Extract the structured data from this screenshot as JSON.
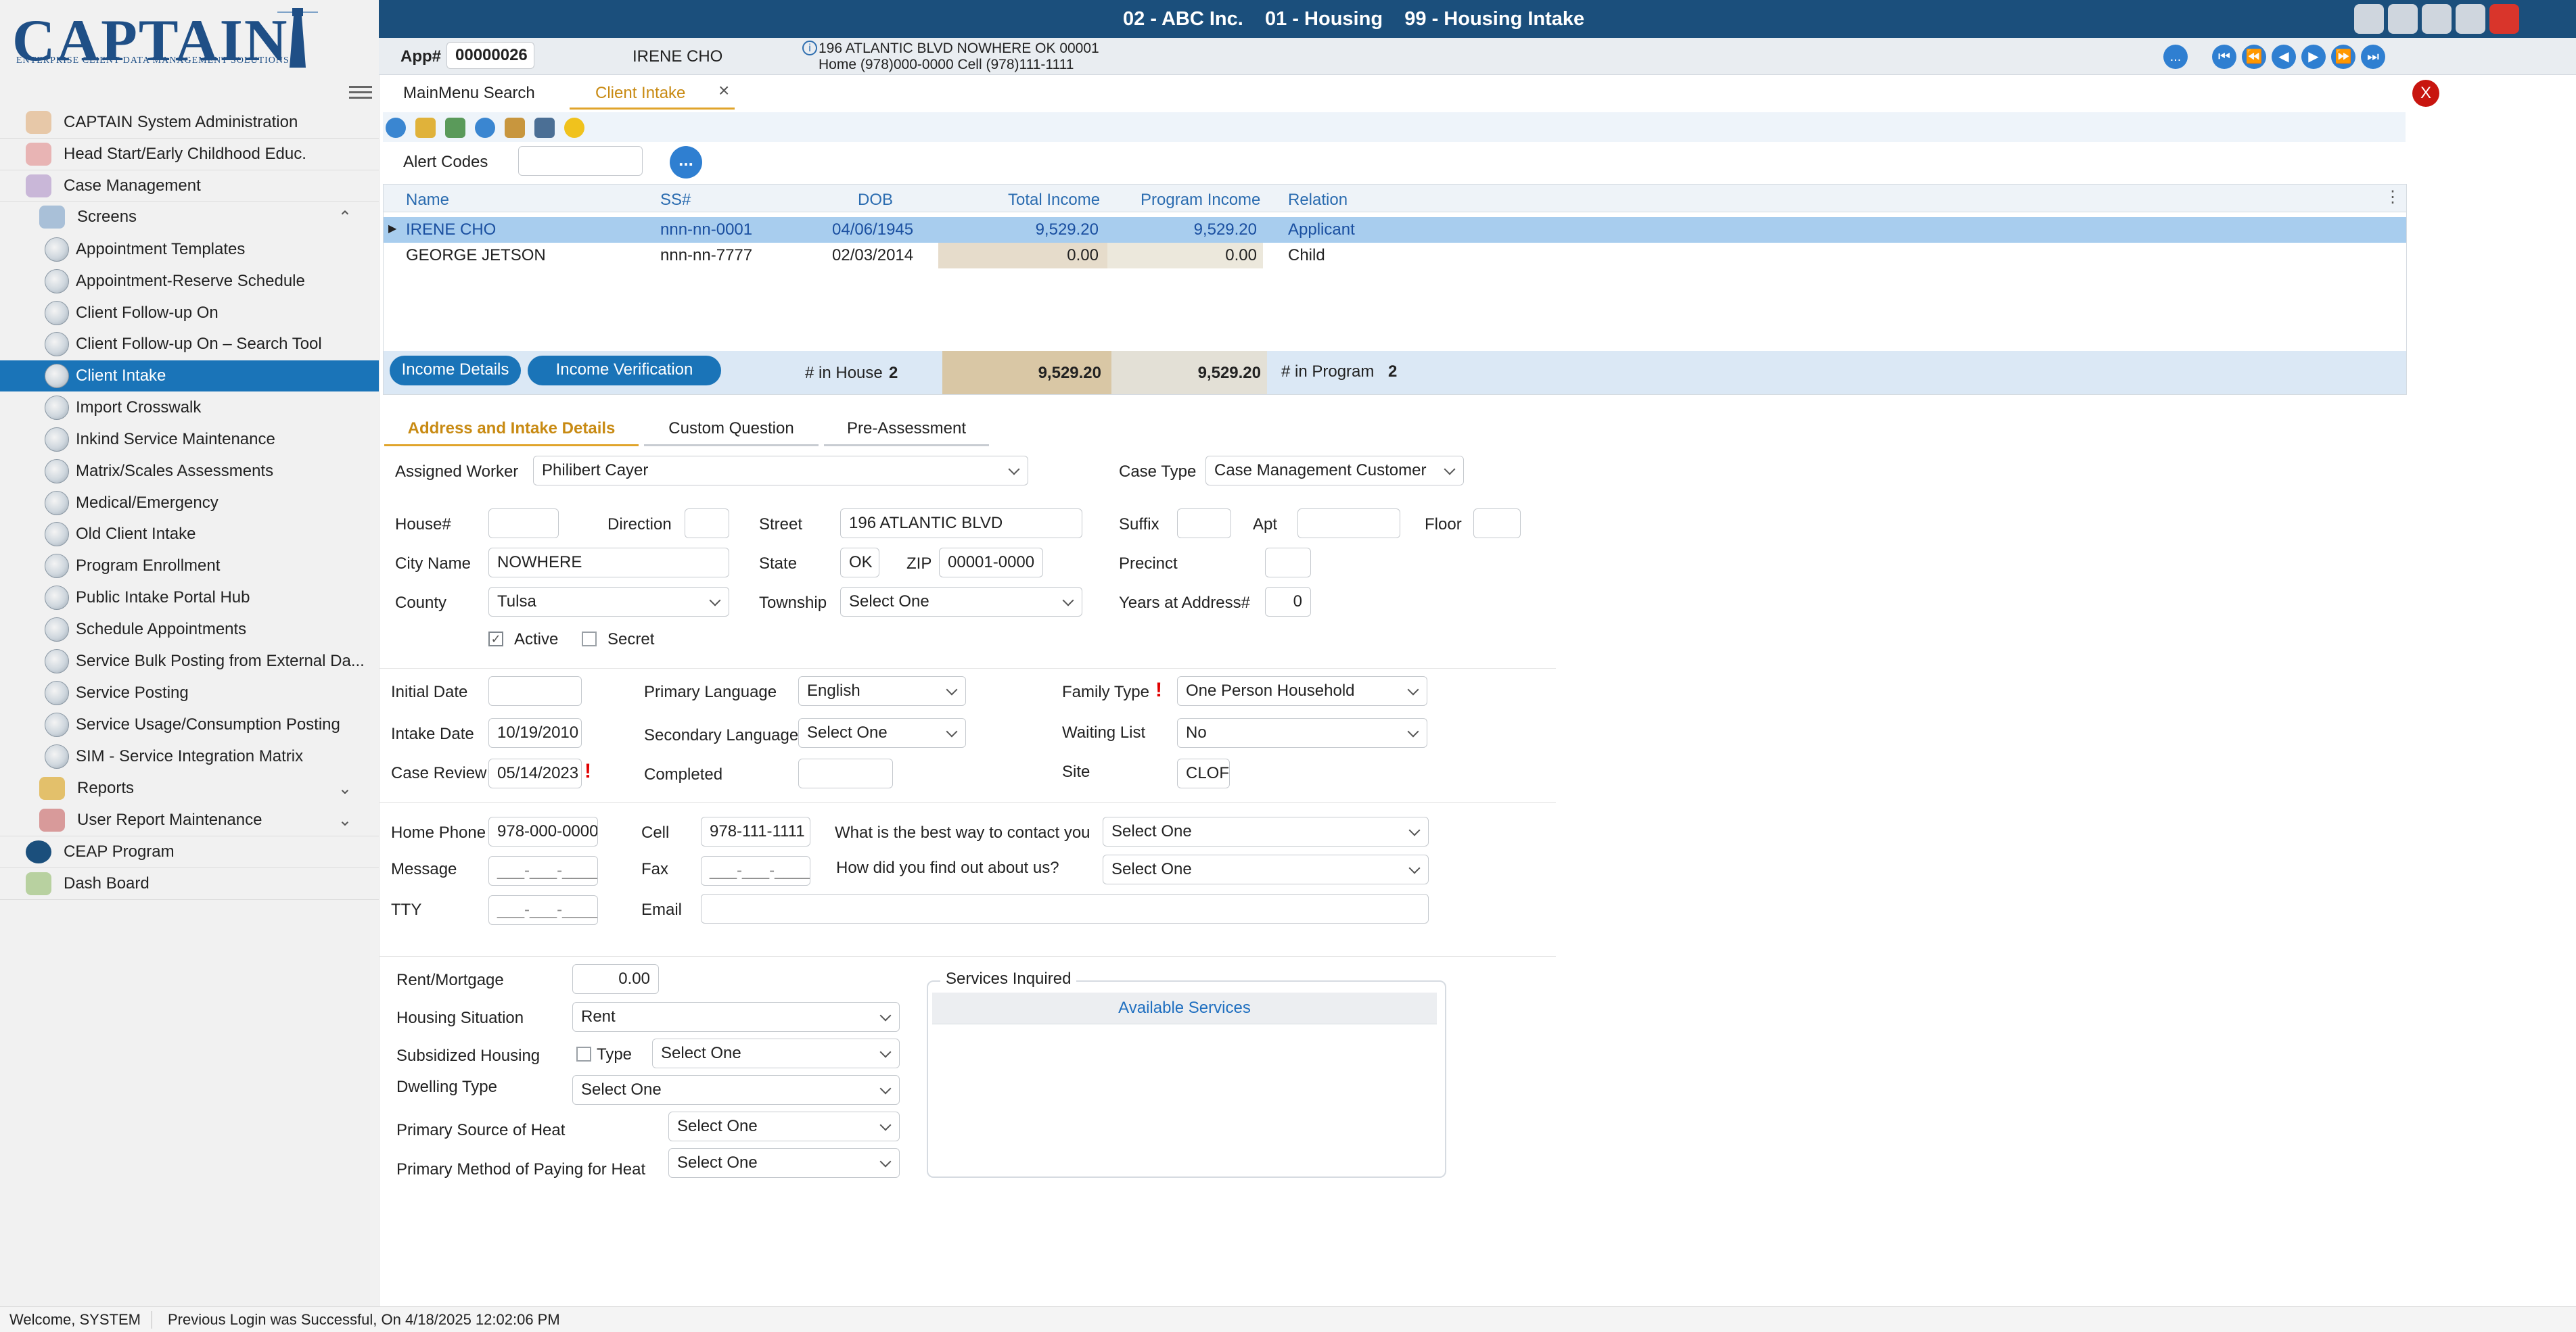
{
  "app": {
    "logo_text": "CAPTAIN",
    "logo_subtitle": "ENTERPRISE CLIENT DATA MANAGEMENT SOLUTIONS",
    "header_title": "02 - ABC Inc.    01 - Housing    99 - Housing Intake",
    "colors": {
      "header": "#1b4f7c",
      "accent": "#1a74b8",
      "required": "#e00000"
    }
  },
  "sidebar": {
    "items": [
      {
        "label": "CAPTAIN System Administration"
      },
      {
        "label": "Head Start/Early Childhood Educ."
      },
      {
        "label": "Case Management"
      },
      {
        "label": "Screens"
      },
      {
        "label": "Appointment Templates"
      },
      {
        "label": "Appointment-Reserve Schedule"
      },
      {
        "label": "Client Follow-up On"
      },
      {
        "label": "Client Follow-up On – Search Tool"
      },
      {
        "label": "Client Intake"
      },
      {
        "label": "Import Crosswalk"
      },
      {
        "label": "Inkind Service Maintenance"
      },
      {
        "label": "Matrix/Scales Assessments"
      },
      {
        "label": "Medical/Emergency"
      },
      {
        "label": "Old Client Intake"
      },
      {
        "label": "Program Enrollment"
      },
      {
        "label": "Public Intake Portal Hub"
      },
      {
        "label": "Schedule Appointments"
      },
      {
        "label": "Service Bulk Posting from External Da..."
      },
      {
        "label": "Service Posting"
      },
      {
        "label": "Service Usage/Consumption Posting"
      },
      {
        "label": "SIM - Service Integration Matrix"
      },
      {
        "label": "Reports"
      },
      {
        "label": "User Report Maintenance"
      },
      {
        "label": "CEAP Program"
      },
      {
        "label": "Dash Board"
      }
    ]
  },
  "client_bar": {
    "app_label": "App#",
    "app_number": "00000026",
    "client_name": "IRENE CHO",
    "address_line": "196 ATLANTIC BLVD NOWHERE OK 00001",
    "phone_line": "Home (978)000-0000 Cell (978)111-1111",
    "more_label": "..."
  },
  "tabs": [
    {
      "label": "MainMenu Search"
    },
    {
      "label": "Client Intake"
    }
  ],
  "close_label": "X",
  "alert": {
    "label": "Alert Codes",
    "value": "",
    "more_label": "..."
  },
  "grid": {
    "headers": [
      "Name",
      "SS#",
      "DOB",
      "Total Income",
      "Program Income",
      "Relation"
    ],
    "rows": [
      {
        "name": "IRENE CHO",
        "ssn": "nnn-nn-0001",
        "dob": "04/06/1945",
        "total": "9,529.20",
        "program": "9,529.20",
        "relation": "Applicant"
      },
      {
        "name": "GEORGE JETSON",
        "ssn": "nnn-nn-7777",
        "dob": "02/03/2014",
        "total": "0.00",
        "program": "0.00",
        "relation": "Child"
      }
    ],
    "income_details_label": "Income Details",
    "income_verification_label": "Income Verification",
    "in_house_label": "# in House",
    "in_house_value": "2",
    "total_income_sum": "9,529.20",
    "program_income_sum": "9,529.20",
    "in_program_label": "# in Program",
    "in_program_value": "2"
  },
  "form_tabs": [
    {
      "label": "Address and Intake Details"
    },
    {
      "label": "Custom Question"
    },
    {
      "label": "Pre-Assessment"
    }
  ],
  "address": {
    "assigned_worker_label": "Assigned Worker",
    "assigned_worker": "Philibert Cayer",
    "case_type_label": "Case Type",
    "case_type": "Case Management Customer",
    "house_label": "House#",
    "house": "",
    "direction_label": "Direction",
    "direction": "",
    "street_label": "Street",
    "street": "196 ATLANTIC BLVD",
    "suffix_label": "Suffix",
    "suffix": "",
    "apt_label": "Apt",
    "apt": "",
    "floor_label": "Floor",
    "floor": "",
    "city_label": "City Name",
    "city": "NOWHERE",
    "state_label": "State",
    "state": "OK",
    "zip_label": "ZIP",
    "zip": "00001-0000",
    "precinct_label": "Precinct",
    "precinct": "",
    "county_label": "County",
    "county": "Tulsa",
    "township_label": "Township",
    "township": "Select One",
    "years_label": "Years at Address#",
    "years": "0",
    "active_label": "Active",
    "secret_label": "Secret"
  },
  "intake": {
    "initial_date_label": "Initial Date",
    "initial_date": "",
    "intake_date_label": "Intake Date",
    "intake_date": "10/19/2010",
    "case_review_label": "Case Review",
    "case_review": "05/14/2023",
    "primary_lang_label": "Primary Language",
    "primary_lang": "English",
    "secondary_lang_label": "Secondary Language",
    "secondary_lang": "Select One",
    "completed_label": "Completed",
    "completed": "",
    "family_type_label": "Family Type",
    "family_type": "One Person Household",
    "waiting_list_label": "Waiting List",
    "waiting_list": "No",
    "site_label": "Site",
    "site": "CLOF",
    "required_mark": "!"
  },
  "contact": {
    "home_phone_label": "Home Phone",
    "home_phone": "978-000-0000",
    "cell_label": "Cell",
    "cell": "978-111-1111",
    "best_way_label": "What is the best way to contact you",
    "best_way": "Select One",
    "message_label": "Message",
    "message": "___-___-____",
    "fax_label": "Fax",
    "fax": "___-___-____",
    "find_out_label": "How did you find out about us?",
    "find_out": "Select One",
    "tty_label": "TTY",
    "tty": "___-___-____",
    "email_label": "Email",
    "email": ""
  },
  "housing": {
    "rent_label": "Rent/Mortgage",
    "rent": "0.00",
    "situation_label": "Housing Situation",
    "situation": "Rent",
    "subsidized_label": "Subsidized Housing",
    "type_label": "Type",
    "subsidized_type": "Select One",
    "dwelling_label": "Dwelling Type",
    "dwelling": "Select One",
    "heat_source_label": "Primary Source of Heat",
    "heat_source": "Select One",
    "heat_pay_label": "Primary Method of Paying for Heat",
    "heat_pay": "Select One",
    "services_label": "Services Inquired",
    "available_services_label": "Available Services"
  },
  "status": {
    "welcome": "Welcome, SYSTEM",
    "login": "Previous Login was Successful, On 4/18/2025 12:02:06 PM"
  }
}
